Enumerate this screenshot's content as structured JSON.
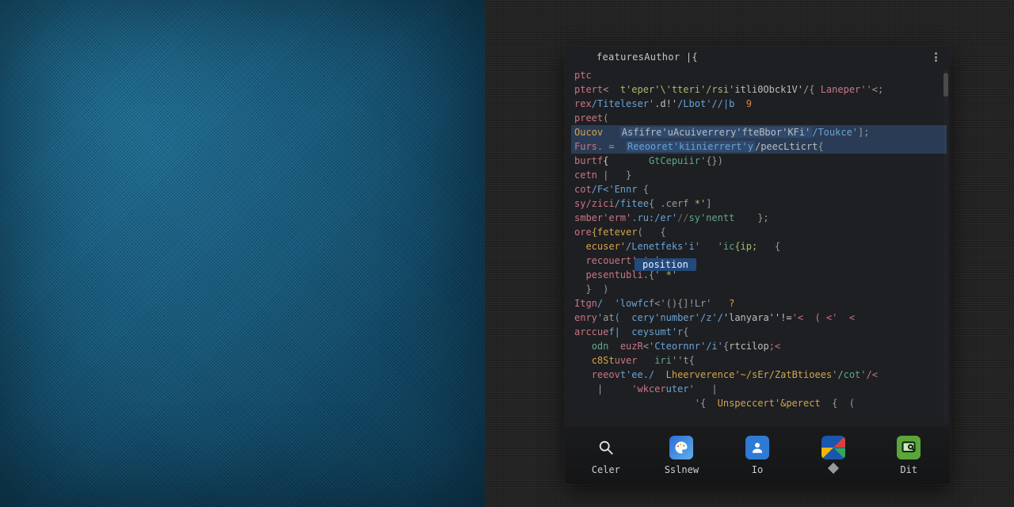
{
  "editor": {
    "tab_title": "featuresAuthor  |{",
    "hint": "position",
    "lines": [
      {
        "tokens": [
          {
            "t": "ptc",
            "c": "tok-kw"
          }
        ]
      },
      {
        "tokens": [
          {
            "t": "ptert",
            "c": "tok-kw"
          },
          {
            "t": "<  ",
            "c": "tok-punc"
          },
          {
            "t": "t'eper'\\'tteri'/rsi'",
            "c": "tok-str"
          },
          {
            "t": "itli0Obck1V'",
            "c": "tok-id"
          },
          {
            "t": "/{ ",
            "c": "tok-punc"
          },
          {
            "t": "Laneper''",
            "c": "tok-mag"
          },
          {
            "t": "<;",
            "c": "tok-punc"
          }
        ]
      },
      {
        "tokens": [
          {
            "t": "rex",
            "c": "tok-kw"
          },
          {
            "t": "/Titeleser'",
            "c": "tok-attr"
          },
          {
            "t": ".d!'",
            "c": "tok-id"
          },
          {
            "t": "/Lbot'//|b  ",
            "c": "tok-attr"
          },
          {
            "t": "9",
            "c": "tok-num"
          }
        ]
      },
      {
        "tokens": [
          {
            "t": "preet",
            "c": "tok-kw"
          },
          {
            "t": "(",
            "c": "tok-punc"
          }
        ]
      },
      {
        "sel": true,
        "tokens": [
          {
            "t": "Oucov",
            "c": "tok-type"
          },
          {
            "t": "   ",
            "c": ""
          },
          {
            "t": "Asfifre'uAcuiverrery'fteBbor'KFi'",
            "c": "tok-id sel"
          },
          {
            "t": "/Toukce'",
            "c": "tok-attr"
          },
          {
            "t": "];",
            "c": "tok-punc"
          }
        ]
      },
      {
        "sel": true,
        "tokens": [
          {
            "t": "Furs.",
            "c": "tok-kw"
          },
          {
            "t": " =  ",
            "c": "tok-punc"
          },
          {
            "t": "Reeooret'kiinierrert'y",
            "c": "tok-attr sel"
          },
          {
            "t": "/peecLticrt",
            "c": "tok-id"
          },
          {
            "t": "{",
            "c": "tok-punc"
          }
        ]
      },
      {
        "tokens": [
          {
            "t": "burtf",
            "c": "tok-kw"
          },
          {
            "t": "{",
            "c": ""
          },
          {
            "t": "       ",
            "c": ""
          },
          {
            "t": "GtCepuiir'",
            "c": "tok-param"
          },
          {
            "t": "{})",
            "c": "tok-punc"
          }
        ]
      },
      {
        "tokens": [
          {
            "t": "cetn",
            "c": "tok-kw"
          },
          {
            "t": " |   }",
            "c": "tok-punc"
          }
        ]
      },
      {
        "tokens": [
          {
            "t": "cot",
            "c": "tok-kw"
          },
          {
            "t": "/F<'Ennr",
            "c": "tok-attr"
          },
          {
            "t": " {",
            "c": "tok-punc"
          }
        ]
      },
      {
        "tokens": [
          {
            "t": "sy/zici",
            "c": "tok-kw"
          },
          {
            "t": "/fitee",
            "c": "tok-attr"
          },
          {
            "t": "{ .cerf ",
            "c": "tok-punc"
          },
          {
            "t": "*'",
            "c": "tok-str"
          },
          {
            "t": "]",
            "c": "tok-punc"
          }
        ]
      },
      {
        "tokens": [
          {
            "t": "smber'erm'",
            "c": "tok-kw"
          },
          {
            "t": ".ru:/er'",
            "c": "tok-attr"
          },
          {
            "t": "//",
            "c": "tok-com"
          },
          {
            "t": "sy'nentt",
            "c": "tok-param"
          },
          {
            "t": "    };",
            "c": "tok-punc"
          }
        ]
      },
      {
        "tokens": [
          {
            "t": "ore",
            "c": "tok-kw"
          },
          {
            "t": "{fetever",
            "c": "tok-fn"
          },
          {
            "t": "(   {",
            "c": "tok-punc"
          }
        ]
      },
      {
        "tokens": [
          {
            "t": "  ",
            "c": ""
          },
          {
            "t": "ecuser'",
            "c": "tok-type"
          },
          {
            "t": "/Lenetfeks'i'",
            "c": "tok-attr"
          },
          {
            "t": "   '",
            "c": "tok-punc"
          },
          {
            "t": "ic",
            "c": "tok-param"
          },
          {
            "t": "{ip;",
            "c": "tok-str"
          },
          {
            "t": "   {",
            "c": "tok-punc"
          }
        ]
      },
      {
        "tokens": [
          {
            "t": "  ",
            "c": ""
          },
          {
            "t": "recouert'r'.",
            "c": "tok-kw"
          },
          {
            "t": "|",
            "c": "tok-punc"
          }
        ]
      },
      {
        "tokens": [
          {
            "t": "  ",
            "c": ""
          },
          {
            "t": "pesentubli",
            "c": "tok-kw"
          },
          {
            "t": ".{' ",
            "c": "tok-punc"
          },
          {
            "t": "*",
            "c": "tok-str"
          },
          {
            "t": "'",
            "c": "tok-punc"
          }
        ]
      },
      {
        "tokens": [
          {
            "t": "  }  )",
            "c": "tok-punc"
          }
        ]
      },
      {
        "tokens": [
          {
            "t": "",
            "c": ""
          }
        ]
      },
      {
        "tokens": [
          {
            "t": "Itgn",
            "c": "tok-kw"
          },
          {
            "t": "/  'lowfcf",
            "c": "tok-attr"
          },
          {
            "t": "<'(){]!Lr'   ",
            "c": "tok-punc"
          },
          {
            "t": "?",
            "c": "tok-type"
          }
        ]
      },
      {
        "tokens": [
          {
            "t": "enry",
            "c": "tok-kw"
          },
          {
            "t": "'at",
            "c": "tok-punc"
          },
          {
            "t": "(  cery'number'/z'/",
            "c": "tok-attr"
          },
          {
            "t": "'lanyara''!",
            "c": "tok-id"
          },
          {
            "t": "=",
            "c": ""
          },
          {
            "t": "'<  ( <'  <",
            "c": "tok-mag"
          }
        ]
      },
      {
        "tokens": [
          {
            "t": "arccue",
            "c": "tok-kw"
          },
          {
            "t": "f|  ceysumt'r",
            "c": "tok-attr"
          },
          {
            "t": "{",
            "c": "tok-punc"
          }
        ]
      },
      {
        "tokens": [
          {
            "t": "   ",
            "c": ""
          },
          {
            "t": "odn",
            "c": "tok-param"
          },
          {
            "t": "  euzR",
            "c": "tok-kw"
          },
          {
            "t": "<'",
            "c": "tok-punc"
          },
          {
            "t": "Cteornnr'/i'",
            "c": "tok-attr"
          },
          {
            "t": "{",
            "c": "tok-punc"
          },
          {
            "t": "rtcilop",
            "c": "tok-id"
          },
          {
            "t": ";<",
            "c": "tok-mag"
          }
        ]
      },
      {
        "tokens": [
          {
            "t": "   ",
            "c": ""
          },
          {
            "t": "c8St",
            "c": "tok-type"
          },
          {
            "t": "uver",
            "c": "tok-kw"
          },
          {
            "t": "   ",
            "c": ""
          },
          {
            "t": "iri",
            "c": "tok-param"
          },
          {
            "t": "''t",
            "c": "tok-punc"
          },
          {
            "t": "{",
            "c": "tok-punc"
          }
        ]
      },
      {
        "tokens": [
          {
            "t": "   ",
            "c": ""
          },
          {
            "t": "reeov",
            "c": "tok-kw"
          },
          {
            "t": "t'ee./",
            "c": "tok-attr"
          },
          {
            "t": "  ",
            "c": ""
          },
          {
            "t": "Lheerverence'~/sEr/ZatBtioees",
            "c": "tok-fn"
          },
          {
            "t": "'/",
            "c": "tok-punc"
          },
          {
            "t": "cot'",
            "c": "tok-param"
          },
          {
            "t": "/<",
            "c": "tok-mag"
          }
        ]
      },
      {
        "tokens": [
          {
            "t": "    |     ",
            "c": "tok-punc"
          },
          {
            "t": "'wkcer",
            "c": "tok-kw"
          },
          {
            "t": "uter",
            "c": "tok-attr"
          },
          {
            "t": "'   |",
            "c": "tok-punc"
          }
        ]
      },
      {
        "tokens": [
          {
            "t": "                     '{  ",
            "c": "tok-punc"
          },
          {
            "t": "Unspeccert'&perect",
            "c": "tok-fn"
          },
          {
            "t": "  {  (",
            "c": "tok-punc"
          }
        ]
      }
    ]
  },
  "taskbar": {
    "items": [
      {
        "id": "search",
        "label": "Celer"
      },
      {
        "id": "palette",
        "label": "Sslnew"
      },
      {
        "id": "contact",
        "label": "Io"
      },
      {
        "id": "mail",
        "label": ""
      },
      {
        "id": "terminal",
        "label": "Dit"
      }
    ]
  }
}
